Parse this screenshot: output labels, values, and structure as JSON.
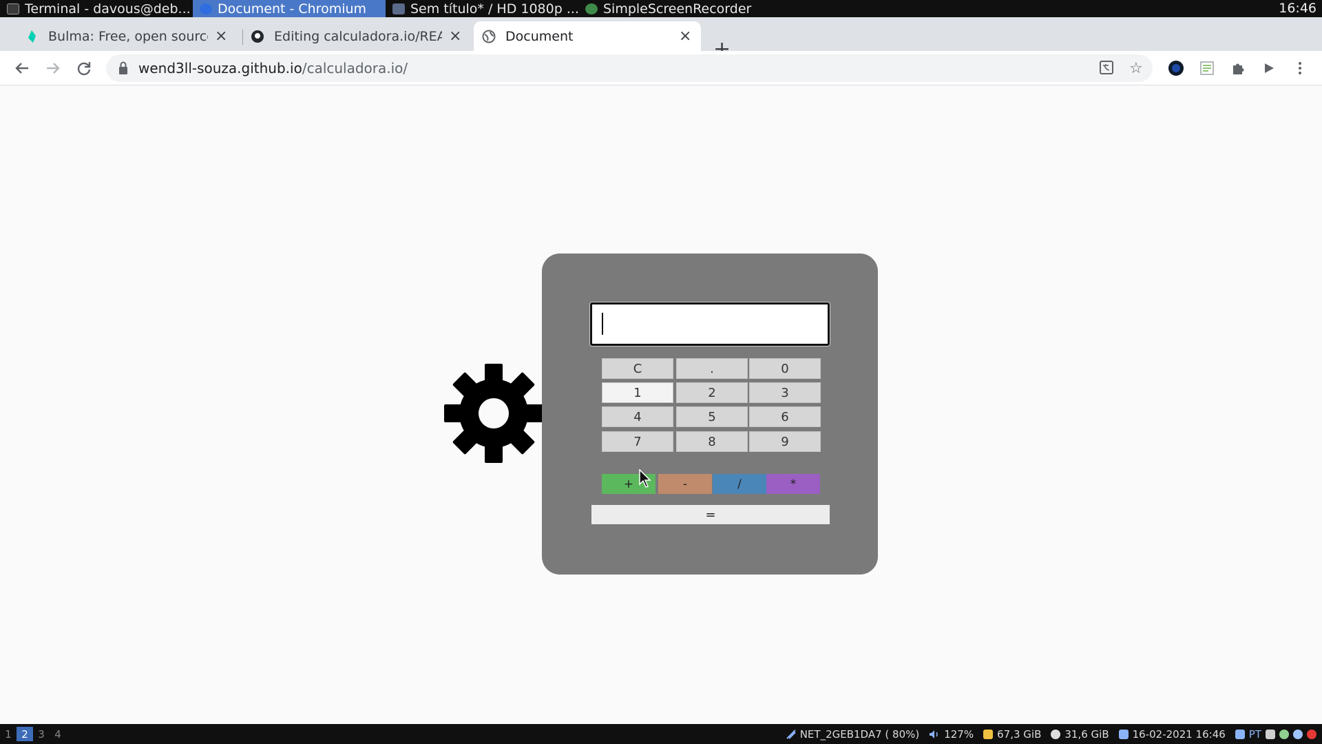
{
  "taskbar": {
    "tasks": [
      {
        "label": "Terminal - davous@deb...",
        "icon": "terminal-icon"
      },
      {
        "label": "Document - Chromium",
        "icon": "chromium-icon"
      },
      {
        "label": "Sem título* / HD 1080p ...",
        "icon": "editor-icon"
      },
      {
        "label": "SimpleScreenRecorder",
        "icon": "recorder-icon"
      }
    ],
    "clock": "16:46"
  },
  "browser": {
    "tabs": [
      {
        "title": "Bulma: Free, open source,",
        "icon": "bulma-icon"
      },
      {
        "title": "Editing calculadora.io/README",
        "icon": "github-icon"
      },
      {
        "title": "Document",
        "icon": "globe-icon"
      }
    ],
    "url_host": "wend3ll-souza.github.io",
    "url_path": "/calculadora.io/"
  },
  "calculator": {
    "display_value": "",
    "keys": [
      "C",
      ".",
      "0",
      "1",
      "2",
      "3",
      "4",
      "5",
      "6",
      "7",
      "8",
      "9"
    ],
    "operators": [
      {
        "label": "+",
        "color": "#5cb85c"
      },
      {
        "label": "-",
        "color": "#c08a6c"
      },
      {
        "label": "/",
        "color": "#4a86b8"
      },
      {
        "label": "*",
        "color": "#9b5fc4"
      }
    ],
    "equals_label": "="
  },
  "panel": {
    "workspaces": [
      "1",
      "2",
      "3",
      "4"
    ],
    "active_workspace": "2",
    "network": "NET_2GEB1DA7 ( 80%)",
    "volume": "127%",
    "disk1": "67,3 GiB",
    "disk2": "31,6 GiB",
    "datetime": "16-02-2021 16:46",
    "locale": "PT"
  }
}
